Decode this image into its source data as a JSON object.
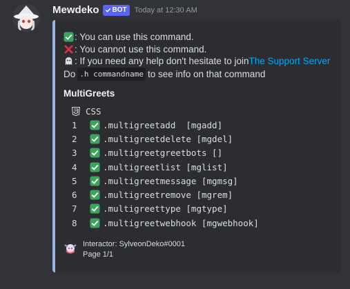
{
  "message": {
    "author": "Mewdeko",
    "bot_badge": "BOT",
    "timestamp": "Today at 12:30 AM",
    "embed_color": "#9ab4e6",
    "embed": {
      "lines": {
        "can_use": ": You can use this command.",
        "cannot_use": ": You cannot use this command.",
        "help_prefix": ": If you need any help don't hesitate to join ",
        "help_link": "The Support Server",
        "do_prefix": "Do ",
        "do_code": ".h commandname",
        "do_suffix": " to see info on that command"
      },
      "field_title": "MultiGreets",
      "code_language": "CSS",
      "commands": [
        {
          "num": "1",
          "text": ".multigreetadd  [mgadd]"
        },
        {
          "num": "2",
          "text": ".multigreetdelete [mgdel]"
        },
        {
          "num": "3",
          "text": ".multigreetgreetbots []"
        },
        {
          "num": "4",
          "text": ".multigreetlist [mglist]"
        },
        {
          "num": "5",
          "text": ".multigreetmessage [mgmsg]"
        },
        {
          "num": "6",
          "text": ".multigreetremove [mgrem]"
        },
        {
          "num": "7",
          "text": ".multigreettype [mgtype]"
        },
        {
          "num": "8",
          "text": ".multigreetwebhook [mgwebhook]"
        }
      ],
      "footer": {
        "interactor": "Interactor: SylveonDeko#0001",
        "page": "Page 1/1"
      }
    },
    "icons": {
      "check": "white-check-mark-icon",
      "cross": "x-mark-icon",
      "help": "ghost-icon",
      "language": "css3-icon"
    }
  }
}
